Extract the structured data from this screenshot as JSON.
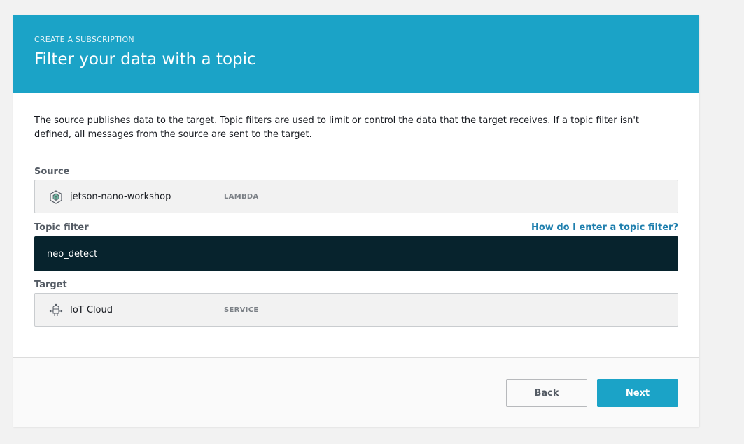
{
  "header": {
    "eyebrow": "CREATE A SUBSCRIPTION",
    "title": "Filter your data with a topic"
  },
  "description": "The source publishes data to the target. Topic filters are used to limit or control the data that the target receives. If a topic filter isn't defined, all messages from the source are sent to the target.",
  "source": {
    "label": "Source",
    "icon": "lambda-cube-icon",
    "name": "jetson-nano-workshop",
    "type": "LAMBDA"
  },
  "topic_filter": {
    "label": "Topic filter",
    "help_link": "How do I enter a topic filter?",
    "value": "neo_detect"
  },
  "target": {
    "label": "Target",
    "icon": "iot-cloud-icon",
    "name": "IoT Cloud",
    "type": "SERVICE"
  },
  "footer": {
    "back_label": "Back",
    "next_label": "Next"
  },
  "colors": {
    "header_bg": "#1ba3c7",
    "topic_input_bg": "#07232d",
    "link": "#1f7fae",
    "primary_button": "#1ba3c7"
  }
}
